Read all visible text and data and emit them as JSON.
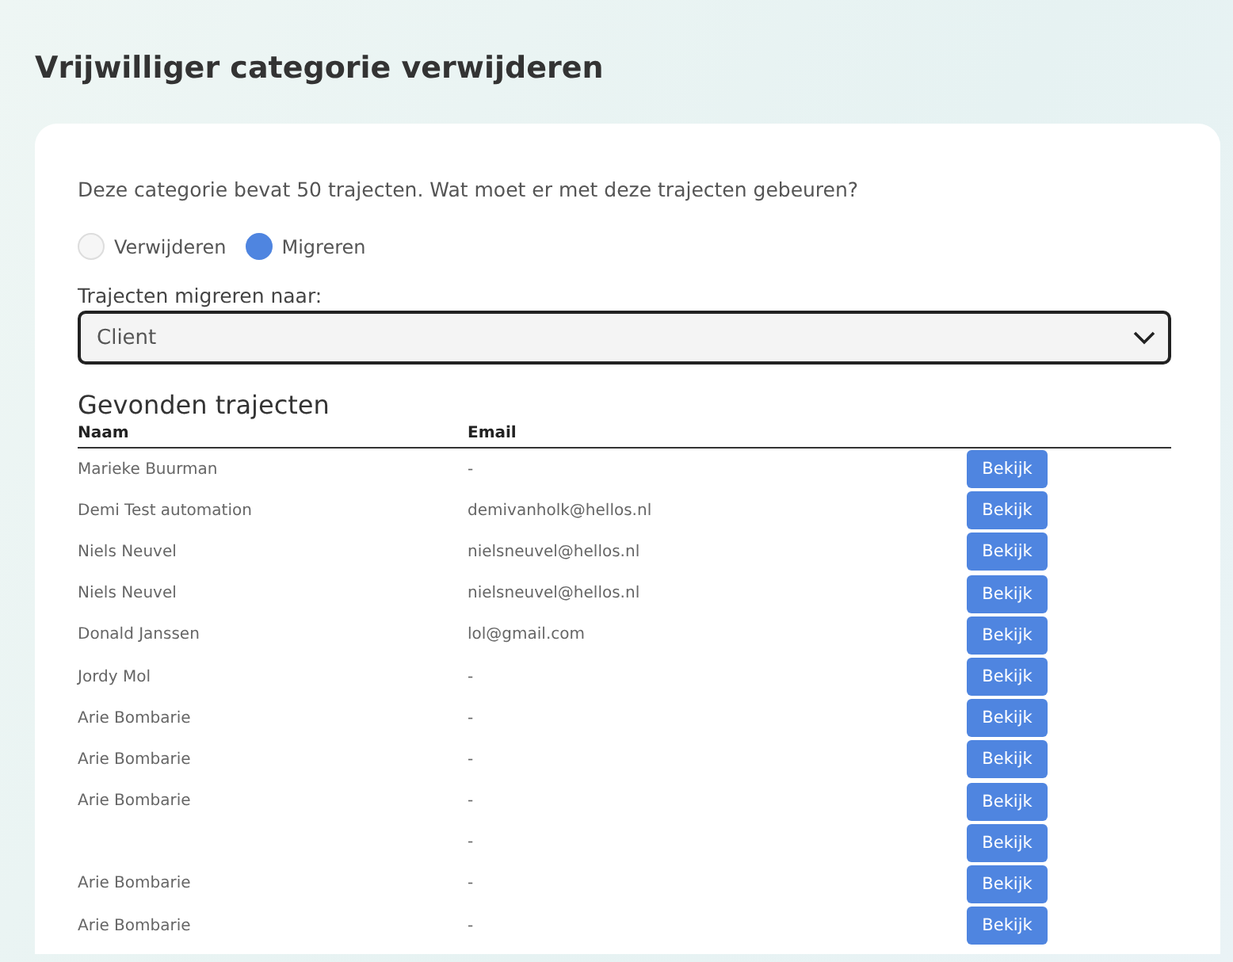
{
  "title": "Vrijwilliger categorie verwijderen",
  "intro": "Deze categorie bevat 50 trajecten. Wat moet er met deze trajecten gebeuren?",
  "options": [
    {
      "label": "Verwijderen",
      "selected": false
    },
    {
      "label": "Migreren",
      "selected": true
    }
  ],
  "migrate": {
    "label": "Trajecten migreren naar:",
    "value": "Client"
  },
  "results": {
    "heading": "Gevonden trajecten",
    "columns": [
      "Naam",
      "Email"
    ],
    "rows": [
      {
        "name": "Marieke Buurman",
        "email": "-",
        "action": "Bekijk"
      },
      {
        "name": "Demi Test automation",
        "email": "demivanholk@hellos.nl",
        "action": "Bekijk"
      },
      {
        "name": "Niels Neuvel",
        "email": "nielsneuvel@hellos.nl",
        "action": "Bekijk"
      },
      {
        "name": "Niels Neuvel",
        "email": "nielsneuvel@hellos.nl",
        "action": "Bekijk"
      },
      {
        "name": "Donald Janssen",
        "email": "lol@gmail.com",
        "action": "Bekijk"
      },
      {
        "name": "Jordy Mol",
        "email": "-",
        "action": "Bekijk"
      },
      {
        "name": "Arie Bombarie",
        "email": "-",
        "action": "Bekijk"
      },
      {
        "name": "Arie Bombarie",
        "email": "-",
        "action": "Bekijk"
      },
      {
        "name": "Arie Bombarie",
        "email": "-",
        "action": "Bekijk"
      },
      {
        "email": "-",
        "action": "Bekijk"
      },
      {
        "name": "Arie Bombarie",
        "email": "-",
        "action": "Bekijk"
      },
      {
        "name": "Arie Bombarie",
        "email": "-",
        "action": "Bekijk"
      }
    ]
  }
}
